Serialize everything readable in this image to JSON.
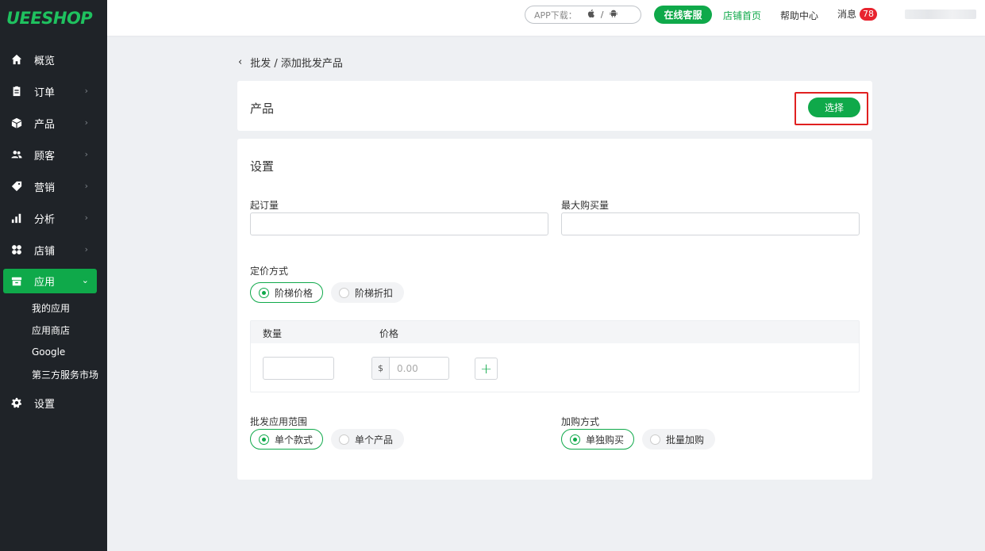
{
  "brand": {
    "logo": "UEESHOP",
    "accent": "#0fa94a"
  },
  "sidebar": {
    "items": [
      {
        "label": "概览",
        "icon": "home-icon",
        "has_children": false
      },
      {
        "label": "订单",
        "icon": "clipboard-icon",
        "has_children": true
      },
      {
        "label": "产品",
        "icon": "box-icon",
        "has_children": true
      },
      {
        "label": "顾客",
        "icon": "users-icon",
        "has_children": true
      },
      {
        "label": "营销",
        "icon": "tag-icon",
        "has_children": true
      },
      {
        "label": "分析",
        "icon": "bar-chart-icon",
        "has_children": true
      },
      {
        "label": "店铺",
        "icon": "grid-icon",
        "has_children": true
      },
      {
        "label": "应用",
        "icon": "archive-icon",
        "has_children": true,
        "active": true
      }
    ],
    "sub_items": [
      "我的应用",
      "应用商店",
      "Google",
      "第三方服务市场"
    ],
    "settings_label": "设置"
  },
  "topbar": {
    "app_download": "APP下载：",
    "app_sep": "/",
    "customer_service": "在线客服",
    "store_home": "店铺首页",
    "help": "帮助中心",
    "messages": "消息",
    "message_count": "78"
  },
  "breadcrumb": {
    "text": "批发 / 添加批发产品"
  },
  "product_card": {
    "title": "产品",
    "select_label": "选择"
  },
  "settings": {
    "title": "设置",
    "min_order_label": "起订量",
    "max_purchase_label": "最大购买量",
    "pricing_label": "定价方式",
    "pricing_options": [
      {
        "label": "阶梯价格",
        "selected": true
      },
      {
        "label": "阶梯折扣",
        "selected": false
      }
    ],
    "tier_table": {
      "qty_header": "数量",
      "price_header": "价格",
      "currency": "$",
      "price_placeholder": "0.00"
    },
    "scope_label": "批发应用范围",
    "scope_options": [
      {
        "label": "单个款式",
        "selected": true
      },
      {
        "label": "单个产品",
        "selected": false
      }
    ],
    "purchase_label": "加购方式",
    "purchase_options": [
      {
        "label": "单独购买",
        "selected": true
      },
      {
        "label": "批量加购",
        "selected": false
      }
    ]
  }
}
